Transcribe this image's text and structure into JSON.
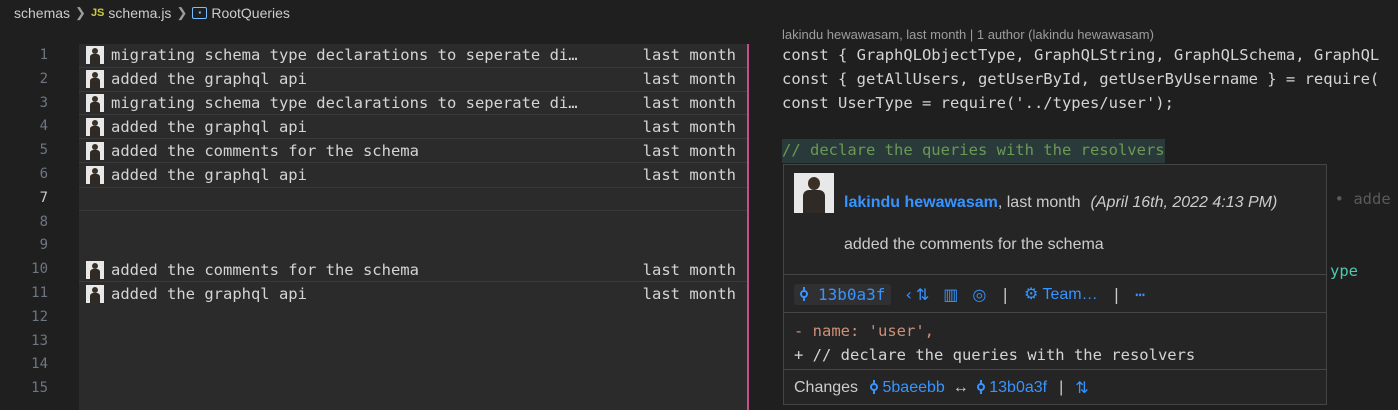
{
  "breadcrumb": {
    "folder": "schemas",
    "file_badge": "JS",
    "file": "schema.js",
    "symbol": "RootQueries"
  },
  "gutter": {
    "line_numbers": [
      "1",
      "2",
      "3",
      "4",
      "5",
      "6",
      "7",
      "8",
      "9",
      "10",
      "11",
      "12",
      "13",
      "14",
      "15"
    ],
    "active_line": "7"
  },
  "blame": {
    "rows": [
      {
        "line": 1,
        "message": "migrating schema type declarations to seperate di…",
        "date": "last month"
      },
      {
        "line": 2,
        "message": "added the graphql api",
        "date": "last month"
      },
      {
        "line": 3,
        "message": "migrating schema type declarations to seperate di…",
        "date": "last month"
      },
      {
        "line": 4,
        "message": "added the graphql api",
        "date": "last month"
      },
      {
        "line": 5,
        "message": "added the comments for the schema",
        "date": "last month"
      },
      {
        "line": 6,
        "message": "added the graphql api",
        "date": "last month"
      },
      {
        "line": 10,
        "message": "added the comments for the schema",
        "date": "last month"
      },
      {
        "line": 11,
        "message": "added the graphql api",
        "date": "last month"
      }
    ]
  },
  "code": {
    "inline_header": "lakindu hewawasam, last month | 1 author (lakindu hewawasam)",
    "lines": [
      "const { GraphQLObjectType, GraphQLString, GraphQLSchema, GraphQL",
      "const { getAllUsers, getUserById, getUserByUsername } = require(",
      "const UserType = require('../types/user');",
      "",
      "// declare the queries with the resolvers"
    ],
    "ghost_right_1": "n • adde",
    "ghost_right_2": "ype"
  },
  "hover": {
    "author": "lakindu hewawasam",
    "when": ", last month",
    "date": "(April 16th, 2022 4:13 PM)",
    "message": "added the comments for the schema",
    "sha": "13b0a3f",
    "actions": {
      "prev_icon": "chevron-left-icon",
      "compare_icon": "compare-changes-icon",
      "panel_icon": "panel-icon",
      "web_icon": "globe-icon",
      "team_label": "Team…",
      "more_label": "⋯"
    },
    "diff_removed": "- name: 'user',",
    "diff_added": "+ // declare the queries with the resolvers",
    "changes_label": "Changes",
    "from_sha": "5baeebb",
    "arrow": "↔",
    "to_sha": "13b0a3f"
  },
  "colors": {
    "accent": "#3794ff",
    "blame_gutter_line": "#c74e8c",
    "comment": "#6a9955"
  }
}
